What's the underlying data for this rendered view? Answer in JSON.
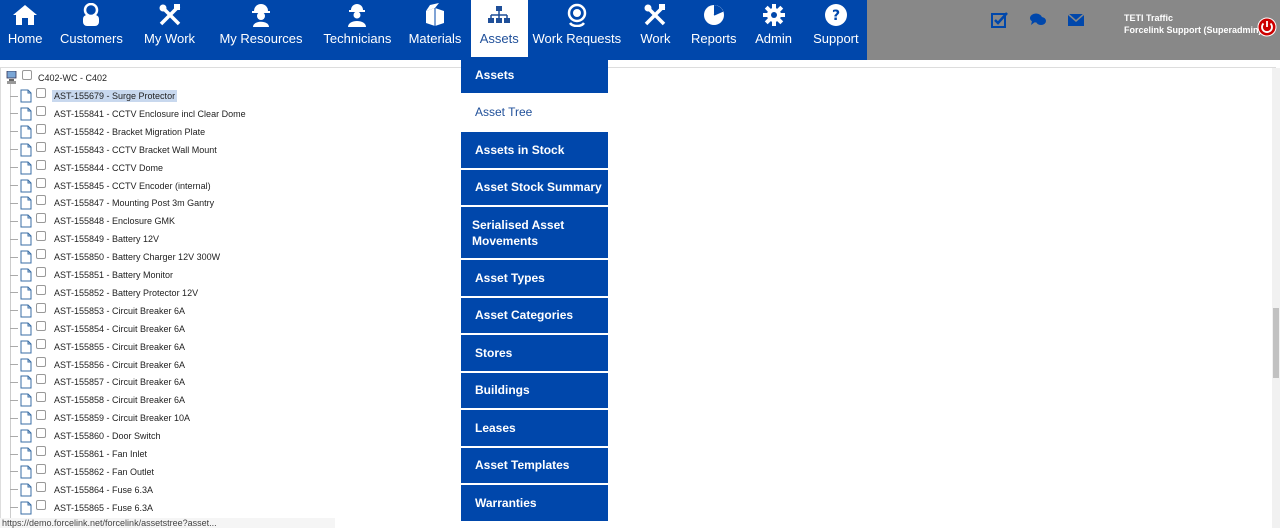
{
  "nav": {
    "items": [
      {
        "label": "Home",
        "icon": "home-icon"
      },
      {
        "label": "Customers",
        "icon": "customers-icon"
      },
      {
        "label": "My Work",
        "icon": "tools-icon"
      },
      {
        "label": "My Resources",
        "icon": "worker-icon"
      },
      {
        "label": "Technicians",
        "icon": "technician-icon"
      },
      {
        "label": "Materials",
        "icon": "materials-box-icon"
      },
      {
        "label": "Assets",
        "icon": "hierarchy-icon"
      },
      {
        "label": "Work Requests",
        "icon": "headset-icon"
      },
      {
        "label": "Work",
        "icon": "tools-icon"
      },
      {
        "label": "Reports",
        "icon": "pie-chart-icon"
      },
      {
        "label": "Admin",
        "icon": "gear-icon"
      },
      {
        "label": "Support",
        "icon": "help-icon"
      }
    ],
    "active": "Assets"
  },
  "header": {
    "company": "TETI Traffic",
    "user": "Forcelink Support (Superadmin)"
  },
  "dropdown": {
    "items": [
      "Assets",
      "Asset Tree",
      "Assets in Stock",
      "Asset Stock Summary",
      "Serialised Asset Movements",
      "Asset Types",
      "Asset Categories",
      "Stores",
      "Buildings",
      "Leases",
      "Asset Templates",
      "Warranties"
    ],
    "active": "Asset Tree"
  },
  "tree": {
    "root": "C402-WC - C402",
    "nodes": [
      "AST-155679 - Surge Protector",
      "AST-155841 - CCTV Enclosure incl Clear Dome",
      "AST-155842 - Bracket Migration Plate",
      "AST-155843 - CCTV Bracket Wall Mount",
      "AST-155844 - CCTV Dome",
      "AST-155845 - CCTV Encoder (internal)",
      "AST-155847 - Mounting Post 3m Gantry",
      "AST-155848 - Enclosure GMK",
      "AST-155849 - Battery 12V",
      "AST-155850 - Battery Charger 12V 300W",
      "AST-155851 - Battery Monitor",
      "AST-155852 - Battery Protector 12V",
      "AST-155853 - Circuit Breaker 6A",
      "AST-155854 - Circuit Breaker 6A",
      "AST-155855 - Circuit Breaker 6A",
      "AST-155856 - Circuit Breaker 6A",
      "AST-155857 - Circuit Breaker 6A",
      "AST-155858 - Circuit Breaker 6A",
      "AST-155859 - Circuit Breaker 10A",
      "AST-155860 - Door Switch",
      "AST-155861 - Fan Inlet",
      "AST-155862 - Fan Outlet",
      "AST-155864 - Fuse 6.3A",
      "AST-155865 - Fuse 6.3A"
    ],
    "selected_index": 0
  },
  "status": {
    "text": "https://demo.forcelink.net/forcelink/assetstree?asset..."
  },
  "colors": {
    "nav_bg": "#0047ab",
    "header_bg": "#888888",
    "selected_bg": "#c8d8ee"
  }
}
